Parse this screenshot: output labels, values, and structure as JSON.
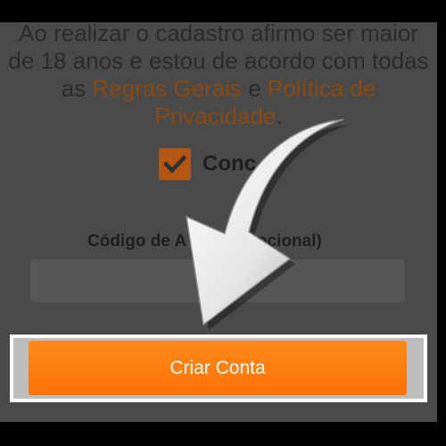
{
  "terms": {
    "line1": "Ao realizar o cadastro afirmo ser maior",
    "line2": "de 18 anos e estou de acordo com todas",
    "line3_prefix": "as ",
    "rules_link": "Regras Gerais",
    "connector": " e ",
    "privacy_link_part1": "Política de",
    "privacy_link_part2": "Privacidade",
    "end_period": "."
  },
  "consent": {
    "label": "Conc",
    "checked": true
  },
  "code_field": {
    "label": "Código de A",
    "label_suffix": "Opcional)",
    "value": ""
  },
  "create_button": {
    "label": "Criar Conta"
  },
  "colors": {
    "accent": "#fd7206",
    "link": "#8a4a12",
    "overlay_background": "#4a4a4a"
  },
  "icons": {
    "checkbox": "checkmark-icon",
    "annotation": "pointer-arrow-icon"
  }
}
